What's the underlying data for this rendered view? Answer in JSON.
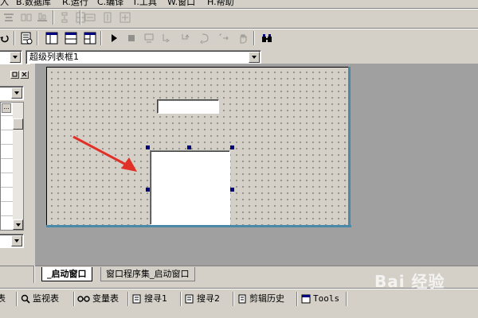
{
  "menu": [
    {
      "key": "A",
      "label": "入"
    },
    {
      "key": "B",
      "label": "B.数据库"
    },
    {
      "key": "R",
      "label": "R.运行"
    },
    {
      "key": "C",
      "label": "C.编译"
    },
    {
      "key": "T",
      "label": "T.工具"
    },
    {
      "key": "W",
      "label": "W.窗口"
    },
    {
      "key": "H",
      "label": "H.帮助"
    }
  ],
  "property_bar": {
    "left_combo_value": "",
    "component_combo_value": "超级列表框1"
  },
  "left_panel": {
    "bottom_label": "序",
    "ellipsis_label": "..."
  },
  "doc_tabs": [
    {
      "label": "_启动窗口",
      "active": true
    },
    {
      "label": "窗口程序集_启动窗口",
      "active": false
    }
  ],
  "bottom_tabs": [
    {
      "label": "表",
      "icon": "table-icon"
    },
    {
      "label": "监视表",
      "icon": "magnifier-icon"
    },
    {
      "label": "变量表",
      "icon": "glasses-icon"
    },
    {
      "label": "搜寻1",
      "icon": "search-list-icon"
    },
    {
      "label": "搜寻2",
      "icon": "search-list-icon"
    },
    {
      "label": "剪辑历史",
      "icon": "clipboard-icon"
    },
    {
      "label": "Tools",
      "icon": "tools-icon"
    }
  ],
  "watermark": "Bai 经验",
  "colors": {
    "window_bg": "#d4d0c8",
    "workspace_bg": "#a0a0a0",
    "selection_handle": "#00007f",
    "annotation_arrow": "#e03028"
  }
}
